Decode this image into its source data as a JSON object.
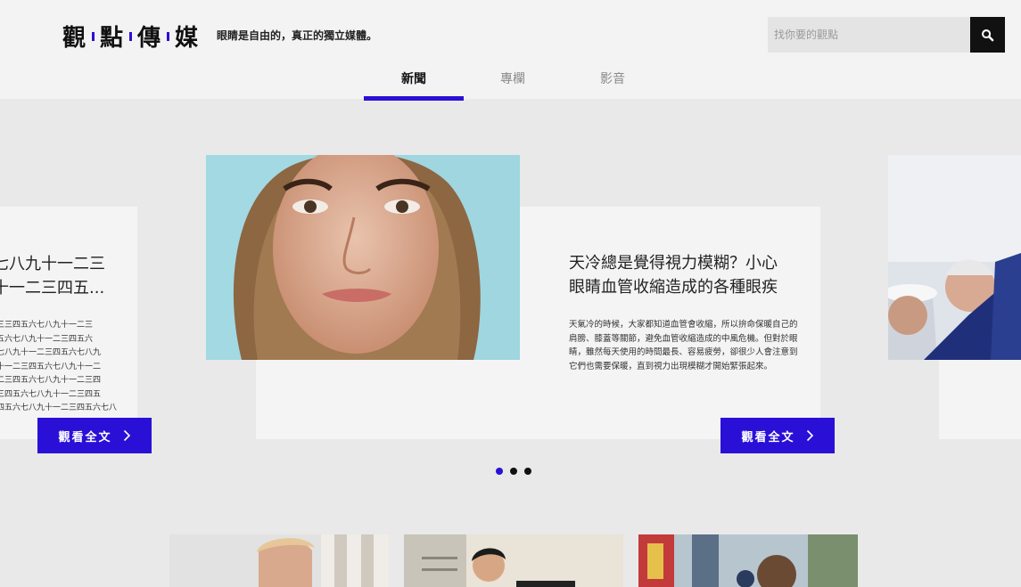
{
  "brand": {
    "name_chars": [
      "觀",
      "點",
      "傳",
      "媒"
    ],
    "slogan": "眼睛是自由的，真正的獨立媒體。",
    "accent_color": "#2a10d6"
  },
  "search": {
    "placeholder": "找你要的觀點",
    "icon": "search-icon"
  },
  "nav": {
    "tabs": [
      {
        "label": "新聞",
        "active": true
      },
      {
        "label": "專欄",
        "active": false
      },
      {
        "label": "影音",
        "active": false
      }
    ]
  },
  "carousel": {
    "left_card": {
      "headline_line1": "七八九十一二三",
      "headline_line2": "十一二三四五...",
      "excerpt": "三三四五六七八九十一二三\n五六七八九十一二三四五六\n七八九十一二三四五六七八九\n十一二三四五六七八九十一二\n二三四五六七八九十一二三四\n三四五六七八九十一二三四五\n四五六七八九十一二三四五六七八",
      "button_label": "觀看全文"
    },
    "main_card": {
      "headline_line1": "天冷總是覺得視力模糊？小心",
      "headline_line2": "眼睛血管收縮造成的各種眼疾",
      "excerpt": "天氣冷的時候，大家都知道血管會收縮，所以拚命保暖自己的肩膀、膝蓋等關節，避免血管收縮造成的中風危機。但對於眼睛，雖然每天使用的時間最長、容易疲勞，卻很少人會注意到它們也需要保暖，直到視力出現模糊才開始緊張起來。",
      "button_label": "觀看全文"
    },
    "dots": [
      {
        "active": true
      },
      {
        "active": false
      },
      {
        "active": false
      }
    ]
  }
}
